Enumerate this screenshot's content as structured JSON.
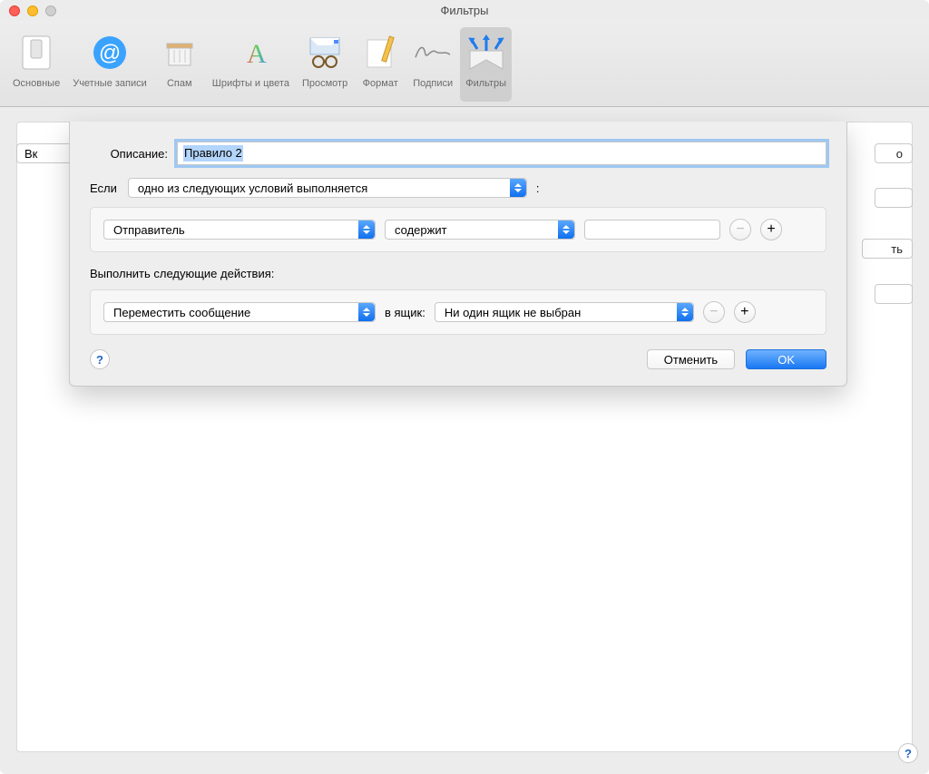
{
  "window": {
    "title": "Фильтры"
  },
  "toolbar": {
    "items": [
      {
        "label": "Основные"
      },
      {
        "label": "Учетные записи"
      },
      {
        "label": "Спам"
      },
      {
        "label": "Шрифты и цвета"
      },
      {
        "label": "Просмотр"
      },
      {
        "label": "Формат"
      },
      {
        "label": "Подписи"
      },
      {
        "label": "Фильтры"
      }
    ],
    "selected_index": 7
  },
  "bg": {
    "checkbox_label_fragment": "Вк",
    "btn1_fragment": "о",
    "btn3_fragment": "ть"
  },
  "sheet": {
    "description_label": "Описание:",
    "description_value": "Правило 2",
    "if_label": "Если",
    "if_dropdown": "одно из следующих условий выполняется",
    "if_colon": ":",
    "conditions": [
      {
        "field": "Отправитель",
        "op": "содержит",
        "value": ""
      }
    ],
    "actions_header": "Выполнить следующие действия:",
    "actions": [
      {
        "verb": "Переместить сообщение",
        "mid": "в ящик:",
        "target": "Ни один ящик не выбран"
      }
    ],
    "cancel": "Отменить",
    "ok": "OK",
    "help": "?"
  }
}
